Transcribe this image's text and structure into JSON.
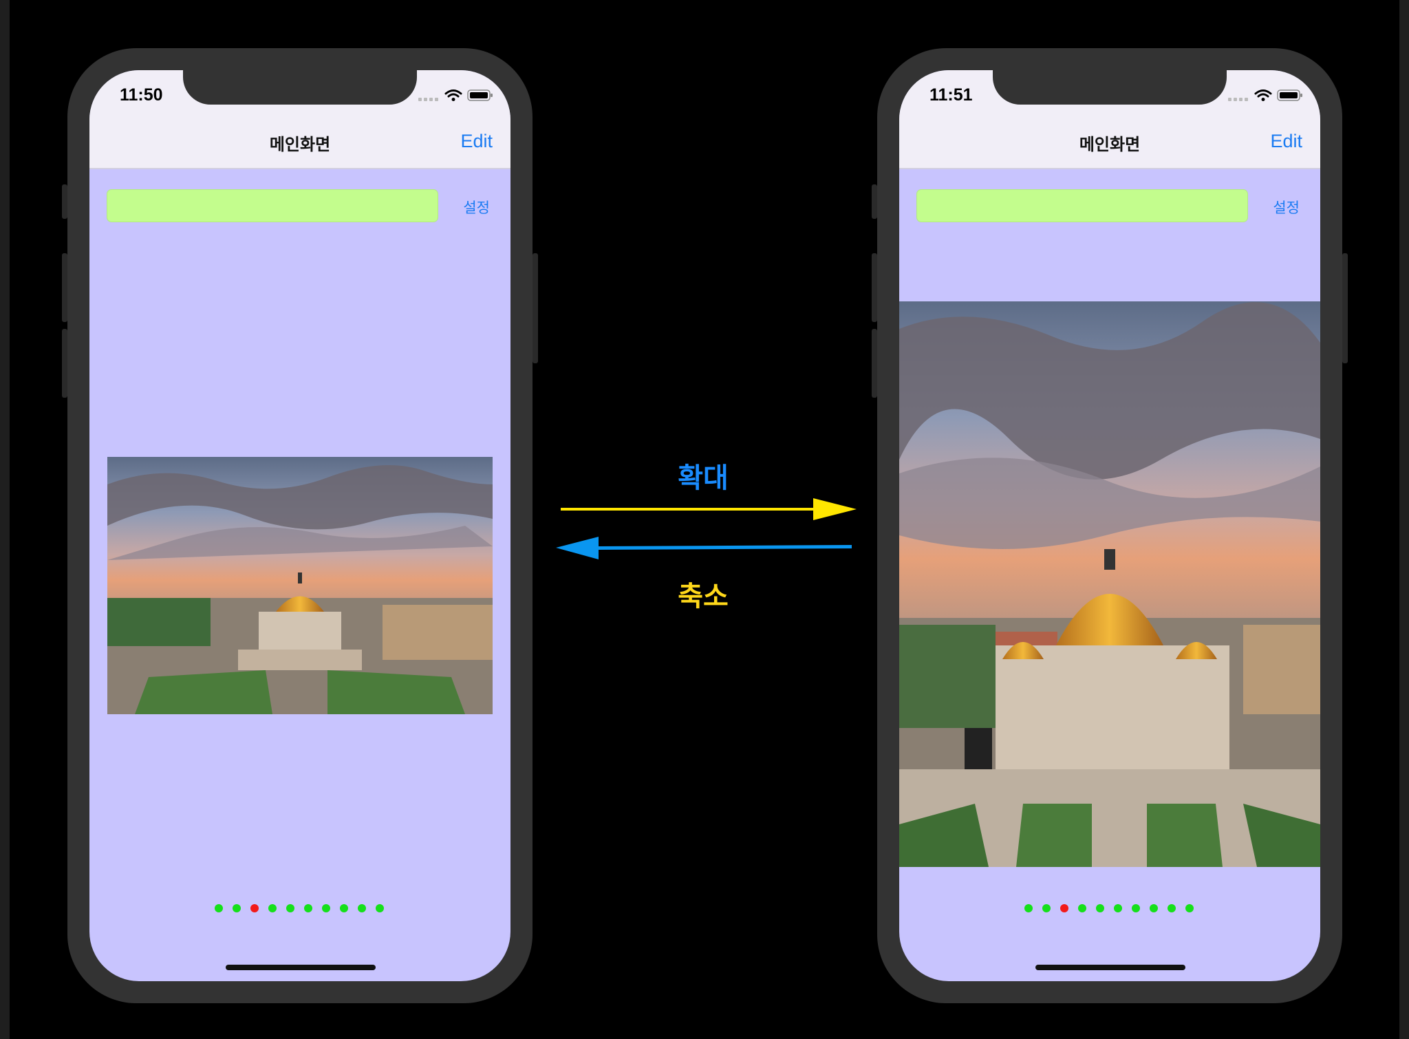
{
  "left_phone": {
    "status": {
      "time": "11:50"
    },
    "nav": {
      "title": "메인화면",
      "edit_label": "Edit"
    },
    "settings_label": "설정",
    "text_field": {
      "value": "",
      "placeholder": ""
    },
    "page_indicator": {
      "count": 10,
      "current_index": 2
    },
    "image_state": "aspect-fit"
  },
  "right_phone": {
    "status": {
      "time": "11:51"
    },
    "nav": {
      "title": "메인화면",
      "edit_label": "Edit"
    },
    "settings_label": "설정",
    "text_field": {
      "value": "",
      "placeholder": ""
    },
    "page_indicator": {
      "count": 10,
      "current_index": 2
    },
    "image_state": "zoomed"
  },
  "annotations": {
    "zoom_in_label": "확대",
    "zoom_out_label": "축소"
  },
  "colors": {
    "background": "#000000",
    "phone_frame": "#333333",
    "screen_background": "#c8c4fe",
    "nav_bar": "#f1eef7",
    "text_field": "#c3fd8d",
    "link_blue": "#1a7bf2",
    "dot_inactive": "#15e01a",
    "dot_active": "#f21a1a",
    "arrow_zoom_in": "#ffe600",
    "arrow_zoom_out": "#0a96f0"
  }
}
